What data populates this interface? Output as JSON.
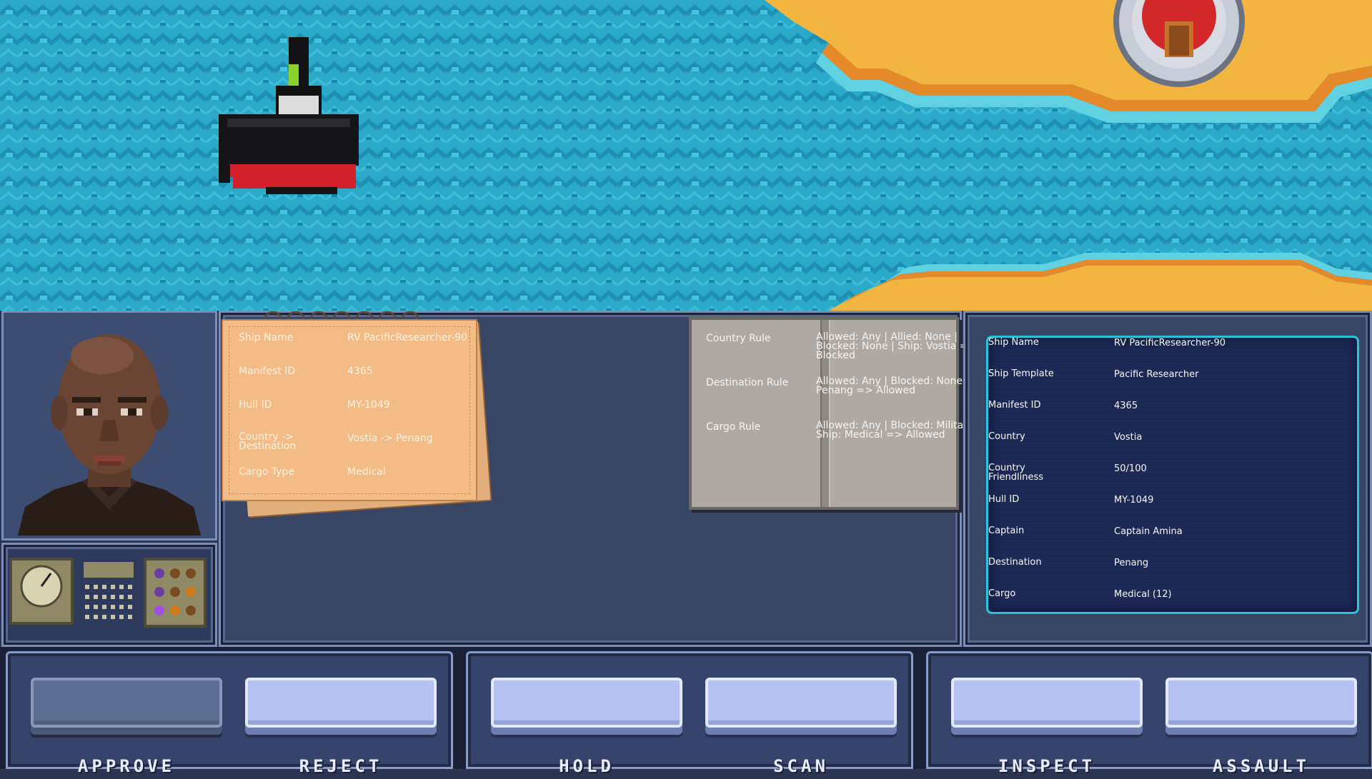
{
  "colors": {
    "sea": "#2aa8c8",
    "sand": "#f2b640",
    "panel": "#384565",
    "accent_cyan": "#2ec9e6"
  },
  "manifest": {
    "rows": [
      {
        "label": "Ship Name",
        "value": "RV PacificResearcher-90"
      },
      {
        "label": "Manifest ID",
        "value": "4365"
      },
      {
        "label": "Hull ID",
        "value": "MY-1049"
      },
      {
        "label": "Country -> Destination",
        "value": "Vostia -> Penang"
      },
      {
        "label": "Cargo Type",
        "value": "Medical"
      }
    ]
  },
  "rulebook": {
    "rows": [
      {
        "label": "Country Rule",
        "value": "Allowed: Any | Allied: None | Blocked: None | Ship: Vostia => Blocked"
      },
      {
        "label": "Destination Rule",
        "value": "Allowed: Any | Blocked: None | Ship: Penang => Allowed"
      },
      {
        "label": "Cargo Rule",
        "value": "Allowed: Any | Blocked: Military | Ship: Medical => Allowed"
      }
    ]
  },
  "terminal": {
    "rows": [
      {
        "label": "Ship Name",
        "value": "RV PacificResearcher-90"
      },
      {
        "label": "Ship Template",
        "value": "Pacific Researcher"
      },
      {
        "label": "Manifest ID",
        "value": "4365"
      },
      {
        "label": "Country",
        "value": "Vostia"
      },
      {
        "label": "Country Friendliness",
        "value": "50/100"
      },
      {
        "label": "Hull ID",
        "value": "MY-1049"
      },
      {
        "label": "Captain",
        "value": "Captain Amina"
      },
      {
        "label": "Destination",
        "value": "Penang"
      },
      {
        "label": "Cargo",
        "value": "Medical (12)"
      }
    ]
  },
  "actions": {
    "approve": "APPROVE",
    "reject": "REJECT",
    "hold": "HOLD",
    "scan": "SCAN",
    "inspect": "INSPECT",
    "assault": "ASSAULT"
  }
}
